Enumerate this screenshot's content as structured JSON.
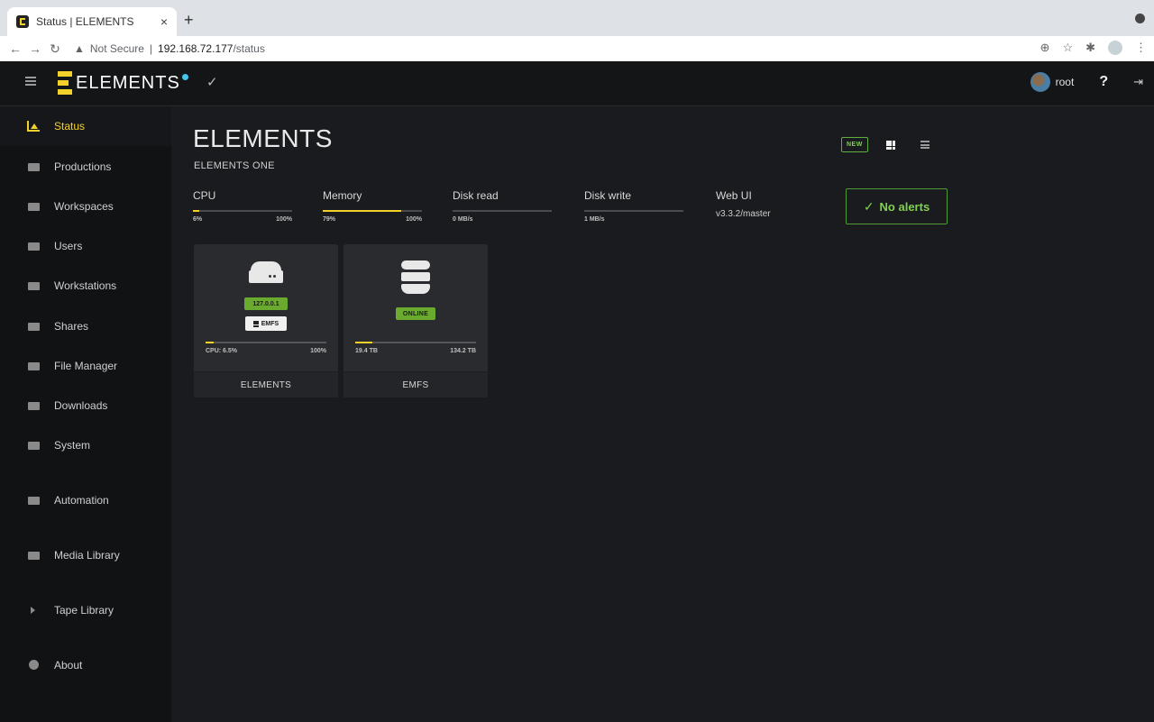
{
  "browser": {
    "tab_title": "Status | ELEMENTS",
    "tab_close": "×",
    "new_tab": "+",
    "security": "Not Secure",
    "host": "192.168.72.177",
    "path": "/status"
  },
  "header": {
    "logo_text": "ELEMENTS",
    "check": "✓",
    "username": "root",
    "help": "?",
    "logout": "⇥"
  },
  "sidebar": {
    "items": [
      {
        "label": "Status",
        "icon": "chart-icon",
        "active": true
      },
      {
        "label": "Productions",
        "icon": "briefcase-icon"
      },
      {
        "label": "Workspaces",
        "icon": "folder-icon"
      },
      {
        "label": "Users",
        "icon": "users-icon"
      },
      {
        "label": "Workstations",
        "icon": "network-icon"
      },
      {
        "label": "Shares",
        "icon": "share-icon"
      },
      {
        "label": "File Manager",
        "icon": "folders-icon"
      },
      {
        "label": "Downloads",
        "icon": "download-icon"
      },
      {
        "label": "System",
        "icon": "wrench-icon"
      },
      {
        "label": "Automation",
        "icon": "gears-icon"
      },
      {
        "label": "Media Library",
        "icon": "film-icon"
      },
      {
        "label": "Tape Library",
        "icon": "caret-right-icon"
      },
      {
        "label": "About",
        "icon": "info-icon"
      }
    ]
  },
  "main": {
    "title": "ELEMENTS",
    "subtitle": "ELEMENTS ONE",
    "new_badge": "NEW",
    "metrics": [
      {
        "label": "CPU",
        "min": "6%",
        "max": "100%",
        "fill": 0.06
      },
      {
        "label": "Memory",
        "min": "79%",
        "max": "100%",
        "fill": 0.79
      },
      {
        "label": "Disk read",
        "min": "0 MB/s",
        "max": "",
        "fill": 0.0
      },
      {
        "label": "Disk write",
        "min": "1 MB/s",
        "max": "",
        "fill": 0.0
      }
    ],
    "webui": {
      "label": "Web UI",
      "value": "v3.3.2/master"
    },
    "alerts": {
      "check": "✓",
      "label": "No alerts"
    },
    "cards": [
      {
        "name": "ELEMENTS",
        "ip": "127.0.0.1",
        "fs_badge": "EMFS",
        "cpu_label": "CPU: 6.5%",
        "max": "100%",
        "fill": 0.065
      },
      {
        "name": "EMFS",
        "status": "ONLINE",
        "used": "19.4 TB",
        "total": "134.2 TB",
        "fill": 0.145
      }
    ]
  },
  "colors": {
    "accent": "#f3d12b",
    "success": "#6aaa2e",
    "background": "#1a1b1e",
    "sidebar": "#111214"
  }
}
